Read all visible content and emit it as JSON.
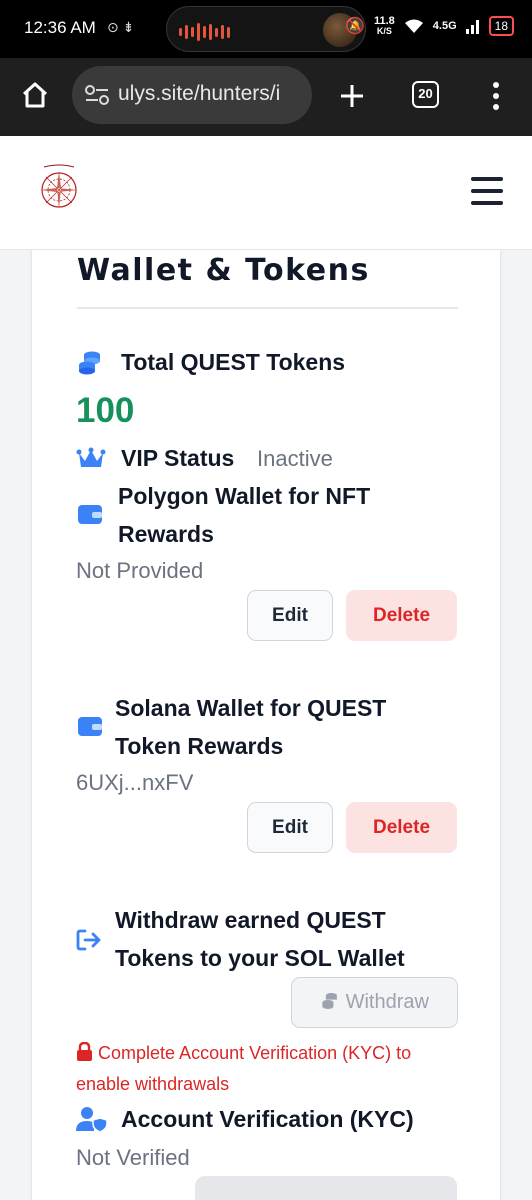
{
  "status_bar": {
    "time": "12:36 AM",
    "network_speed": "11.8",
    "network_speed_unit": "K/S",
    "signal_type": "4.5G",
    "battery": "18"
  },
  "browser": {
    "url": "ulys.site/hunters/i",
    "tab_count": "20"
  },
  "wallet_section": {
    "title": "Wallet & Tokens",
    "total_tokens_label": "Total QUEST Tokens",
    "total_tokens_value": "100",
    "vip_label": "VIP Status",
    "vip_value": "Inactive",
    "polygon_label": "Polygon Wallet for NFT Rewards",
    "polygon_value": "Not Provided",
    "polygon_edit": "Edit",
    "polygon_delete": "Delete",
    "solana_label": "Solana Wallet for QUEST Token Rewards",
    "solana_value": "6UXj...nxFV",
    "solana_edit": "Edit",
    "solana_delete": "Delete",
    "withdraw_label": "Withdraw earned QUEST Tokens to your SOL Wallet",
    "withdraw_button": "Withdraw",
    "kyc_warning": "Complete Account Verification (KYC) to enable withdrawals",
    "kyc_label": "Account Verification (KYC)",
    "kyc_value": "Not Verified"
  },
  "colors": {
    "accent_blue": "#3b82f6",
    "token_green": "#17915b",
    "danger_red": "#dc2626"
  }
}
